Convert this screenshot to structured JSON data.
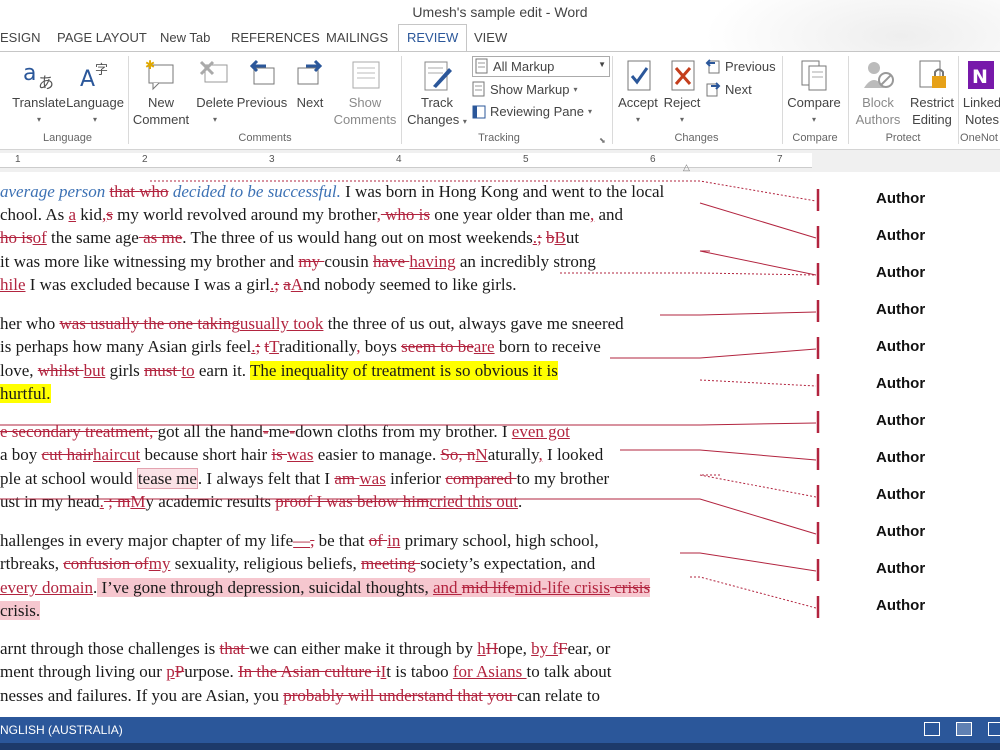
{
  "window": {
    "title": "Umesh's sample edit - Word"
  },
  "tabs": [
    {
      "label": "ESIGN"
    },
    {
      "label": "PAGE LAYOUT"
    },
    {
      "label": "New Tab"
    },
    {
      "label": "REFERENCES"
    },
    {
      "label": "MAILINGS"
    },
    {
      "label": "REVIEW",
      "active": true
    },
    {
      "label": "VIEW"
    }
  ],
  "ribbon": {
    "language": {
      "translate": "Translate",
      "language": "Language",
      "group": "Language"
    },
    "comments": {
      "new": "New Comment",
      "delete": "Delete",
      "previous": "Previous",
      "next": "Next",
      "show": "Show Comments",
      "group": "Comments"
    },
    "tracking": {
      "track_changes": "Track Changes",
      "markup_value": "All Markup",
      "show_markup": "Show Markup",
      "reviewing_pane": "Reviewing Pane",
      "group": "Tracking"
    },
    "changes": {
      "accept": "Accept",
      "reject": "Reject",
      "previous": "Previous",
      "next": "Next",
      "group": "Changes"
    },
    "compare": {
      "compare": "Compare",
      "group": "Compare"
    },
    "protect": {
      "block_authors": "Block Authors",
      "restrict_editing": "Restrict Editing",
      "group": "Protect"
    },
    "onenote": {
      "linked_notes": "Linked Notes",
      "group": "OneNot"
    }
  },
  "ruler": {
    "numbers": [
      "1",
      "2",
      "3",
      "4",
      "5",
      "6",
      "7"
    ]
  },
  "comments": [
    "Author",
    "Author",
    "Author",
    "Author",
    "Author",
    "Author",
    "Author",
    "Author",
    "Author",
    "Author",
    "Author",
    "Author"
  ],
  "status": {
    "language": "NGLISH (AUSTRALIA)"
  },
  "colors": {
    "accent": "#2b579a",
    "revision": "#b2243f",
    "highlight": "#ffff00",
    "comment": "#f6c7cf"
  },
  "document": [
    [
      [
        "i",
        "average person "
      ],
      [
        "d",
        "that "
      ],
      [
        "d",
        "who"
      ],
      [
        "i",
        " decided to be successful."
      ],
      [
        "n",
        " I was born in Hong Kong and went to the local"
      ]
    ],
    [
      [
        "n",
        "chool. As "
      ],
      [
        "ins",
        "a"
      ],
      [
        "n",
        " kid"
      ],
      [
        "ins",
        ","
      ],
      [
        "d",
        "s"
      ],
      [
        "n",
        " my world revolved around my brother"
      ],
      [
        "ins",
        ","
      ],
      [
        "d",
        " who is"
      ],
      [
        "n",
        " one year older than me"
      ],
      [
        "ins",
        ","
      ],
      [
        "n",
        " and"
      ]
    ],
    [
      [
        "d",
        "ho is"
      ],
      [
        "ins",
        "of"
      ],
      [
        "n",
        " the same age"
      ],
      [
        "d",
        " as me"
      ],
      [
        "n",
        ". The three of us would hang out on most weekends"
      ],
      [
        "ins",
        "."
      ],
      [
        "d",
        ";"
      ],
      [
        "n",
        " "
      ],
      [
        "d",
        "b"
      ],
      [
        "ins",
        "B"
      ],
      [
        "n",
        "ut"
      ]
    ],
    [
      [
        "n",
        "it was more like witnessing my brother and "
      ],
      [
        "d",
        "my "
      ],
      [
        "n",
        "cousin "
      ],
      [
        "d",
        "have "
      ],
      [
        "ins",
        "having"
      ],
      [
        "n",
        " an incredibly strong"
      ]
    ],
    [
      [
        "ins",
        "hile"
      ],
      [
        "n",
        " I was excluded because I was a girl"
      ],
      [
        "ins",
        "."
      ],
      [
        "d",
        ";"
      ],
      [
        "n",
        " "
      ],
      [
        "d",
        "a"
      ],
      [
        "ins",
        "A"
      ],
      [
        "n",
        "nd nobody seemed to like girls."
      ]
    ],
    [
      [
        "n",
        "her who "
      ],
      [
        "d",
        "was usually the one taking"
      ],
      [
        "ins",
        "usually took"
      ],
      [
        "n",
        " the three of us out, always gave me sneered"
      ]
    ],
    [
      [
        "n",
        "is perhaps how many Asian girls feel"
      ],
      [
        "ins",
        "."
      ],
      [
        "d",
        ";"
      ],
      [
        "n",
        " "
      ],
      [
        "d",
        "t"
      ],
      [
        "ins",
        "T"
      ],
      [
        "n",
        "raditionally"
      ],
      [
        "ins",
        ","
      ],
      [
        "n",
        " boys "
      ],
      [
        "d",
        "seem to be"
      ],
      [
        "ins",
        "are"
      ],
      [
        "n",
        " born to receive"
      ]
    ],
    [
      [
        "n",
        "love, "
      ],
      [
        "d",
        "whilst "
      ],
      [
        "ins",
        "but"
      ],
      [
        "n",
        " girls "
      ],
      [
        "d",
        "must "
      ],
      [
        "ins",
        "to"
      ],
      [
        "n",
        " earn it. "
      ],
      [
        "h",
        "The inequality of treatment is so obvious it is"
      ]
    ],
    [
      [
        "h",
        "hurtful."
      ]
    ],
    [
      [
        "d",
        "e secondary treatment, "
      ],
      [
        "n",
        "got all the hand"
      ],
      [
        "d",
        "-"
      ],
      [
        "n",
        "me"
      ],
      [
        "d",
        "-"
      ],
      [
        "n",
        "down cloths from my brother. I "
      ],
      [
        "ins",
        "even got"
      ]
    ],
    [
      [
        "n",
        "a boy "
      ],
      [
        "d",
        "cut hair"
      ],
      [
        "ins",
        "haircut"
      ],
      [
        "n",
        " because short hair "
      ],
      [
        "d",
        "is "
      ],
      [
        "ins",
        "was"
      ],
      [
        "n",
        " easier to manage. "
      ],
      [
        "d",
        " So, n"
      ],
      [
        "ins",
        "N"
      ],
      [
        "n",
        "aturally"
      ],
      [
        "ins",
        ","
      ],
      [
        "n",
        " I looked"
      ]
    ],
    [
      [
        "n",
        "ple at school would "
      ],
      [
        "cb",
        "tease me"
      ],
      [
        "n",
        ". I always felt that I "
      ],
      [
        "d",
        "am "
      ],
      [
        "ins",
        "was"
      ],
      [
        "n",
        " inferior "
      ],
      [
        "d",
        "compared "
      ],
      [
        "n",
        "to my brother"
      ]
    ],
    [
      [
        "n",
        "ust in my head"
      ],
      [
        "ins",
        "."
      ],
      [
        "d",
        " ; m"
      ],
      [
        "ins",
        "M"
      ],
      [
        "n",
        "y academic results "
      ],
      [
        "d",
        "proof I was below him"
      ],
      [
        "ins",
        "cried this out"
      ],
      [
        "n",
        "."
      ]
    ],
    [
      [
        "n",
        "hallenges in every major chapter of my life"
      ],
      [
        "ins",
        "—"
      ],
      [
        "d",
        ","
      ],
      [
        "n",
        " be that "
      ],
      [
        "d",
        "of "
      ],
      [
        "ins",
        "in"
      ],
      [
        "n",
        " primary school, high school,"
      ]
    ],
    [
      [
        "n",
        "rtbreaks, "
      ],
      [
        "d",
        "confusion of"
      ],
      [
        "ins",
        "my"
      ],
      [
        "n",
        " sexuality, religious beliefs, "
      ],
      [
        "d",
        "meeting "
      ],
      [
        "n",
        "society’s expectation, and"
      ]
    ],
    [
      [
        "ins",
        "every domain"
      ],
      [
        "n",
        "."
      ],
      [
        "c",
        " I’ve gone through depression, suicidal thoughts, "
      ],
      [
        "ic",
        "and "
      ],
      [
        "dc",
        "mid life"
      ],
      [
        "ic",
        "mid-life crisis"
      ],
      [
        "dc",
        " crisis"
      ]
    ],
    [
      [
        "c",
        "crisis."
      ]
    ],
    [
      [
        "n",
        "arnt through those challenges is "
      ],
      [
        "d",
        "that "
      ],
      [
        "n",
        "we can either make it through by "
      ],
      [
        "ins",
        "h"
      ],
      [
        "d",
        "H"
      ],
      [
        "n",
        "ope, "
      ],
      [
        "ins",
        "by f"
      ],
      [
        "d",
        "F"
      ],
      [
        "n",
        "ear, or"
      ]
    ],
    [
      [
        "n",
        "ment through living our "
      ],
      [
        "ins",
        "p"
      ],
      [
        "d",
        "P"
      ],
      [
        "n",
        "urpose. "
      ],
      [
        "d",
        "In the Asian culture i"
      ],
      [
        "ins",
        "I"
      ],
      [
        "n",
        "t is taboo "
      ],
      [
        "ins",
        "for Asians "
      ],
      [
        "n",
        "to talk about"
      ]
    ],
    [
      [
        "n",
        "nesses and failures. If you are Asian, you "
      ],
      [
        "d",
        "probably will understand that you "
      ],
      [
        "n",
        "can relate to"
      ]
    ]
  ]
}
